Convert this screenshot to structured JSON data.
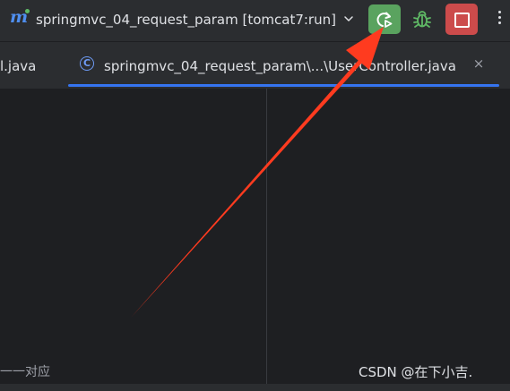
{
  "toolbar": {
    "logo_text": "m",
    "run_config": "springmvc_04_request_param [tomcat7:run]",
    "icons": {
      "config_dropdown": "chevron-down-icon",
      "rerun": "rerun-icon",
      "debug": "bug-icon",
      "stop": "stop-icon",
      "more": "more-vertical-icon"
    },
    "colors": {
      "rerun": "#5aa35f",
      "stop": "#cc4b4b",
      "debug": "#5fb865"
    }
  },
  "tabs": {
    "previous": "l.java",
    "active": {
      "icon": "class-icon",
      "icon_glyph": "C",
      "label": "springmvc_04_request_param\\...\\UserController.java",
      "close_glyph": "×"
    },
    "accent": "#3574f0"
  },
  "editor": {
    "bottom_text": "一一对应"
  },
  "annotation": {
    "arrow_color": "#ff3b1f"
  },
  "watermark": "CSDN @在下小吉."
}
